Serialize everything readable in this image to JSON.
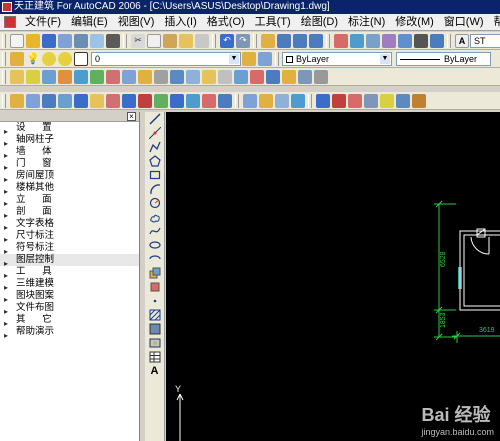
{
  "window": {
    "title": "天正建筑 For AutoCAD 2006 - [C:\\Users\\ASUS\\Desktop\\Drawing1.dwg]"
  },
  "menu": {
    "items": [
      {
        "label": "文件(F)"
      },
      {
        "label": "编辑(E)"
      },
      {
        "label": "视图(V)"
      },
      {
        "label": "插入(I)"
      },
      {
        "label": "格式(O)"
      },
      {
        "label": "工具(T)"
      },
      {
        "label": "绘图(D)"
      },
      {
        "label": "标注(N)"
      },
      {
        "label": "修改(M)"
      },
      {
        "label": "窗口(W)"
      },
      {
        "label": "帮助(H)"
      }
    ]
  },
  "layer_bar": {
    "layer_value": "0",
    "color_value": "ByLayer",
    "linetype_value": "ByLayer",
    "style_value": "ST"
  },
  "sidebar": {
    "close_label": "×",
    "items": [
      {
        "label": "设 置",
        "spaced": true
      },
      {
        "label": "轴网柱子"
      },
      {
        "label": "墙 体",
        "spaced": true
      },
      {
        "label": "门 窗",
        "spaced": true
      },
      {
        "label": "房间屋顶"
      },
      {
        "label": "楼梯其他"
      },
      {
        "label": "立 面",
        "spaced": true
      },
      {
        "label": "剖 面",
        "spaced": true
      },
      {
        "label": "文字表格"
      },
      {
        "label": "尺寸标注"
      },
      {
        "label": "符号标注"
      },
      {
        "label": "图层控制",
        "selected": true
      },
      {
        "label": "工 具",
        "spaced": true
      },
      {
        "label": "三维建模"
      },
      {
        "label": "图块图案"
      },
      {
        "label": "文件布图"
      },
      {
        "label": "其 它",
        "spaced": true
      },
      {
        "label": "帮助演示"
      }
    ]
  },
  "drawing": {
    "dimension_vertical_top": "6528",
    "dimension_vertical_bottom": "1853",
    "dimension_horizontal": "3619",
    "axis_y_label": "Y",
    "colors": {
      "dimension": "#2ecc40",
      "wall": "#ffffff",
      "window": "#3aa6a6"
    }
  },
  "watermark": {
    "text": "Bai 经验",
    "url": "jingyan.baidu.com"
  },
  "icons": [
    "new-file-icon",
    "open-icon",
    "save-icon",
    "print-icon",
    "cut-icon",
    "copy-icon",
    "paste-icon",
    "undo-icon",
    "redo-icon",
    "pan-icon",
    "zoom-icon",
    "layer-icon",
    "line-icon",
    "polyline-icon",
    "circle-icon",
    "arc-icon",
    "rectangle-icon",
    "text-icon"
  ]
}
